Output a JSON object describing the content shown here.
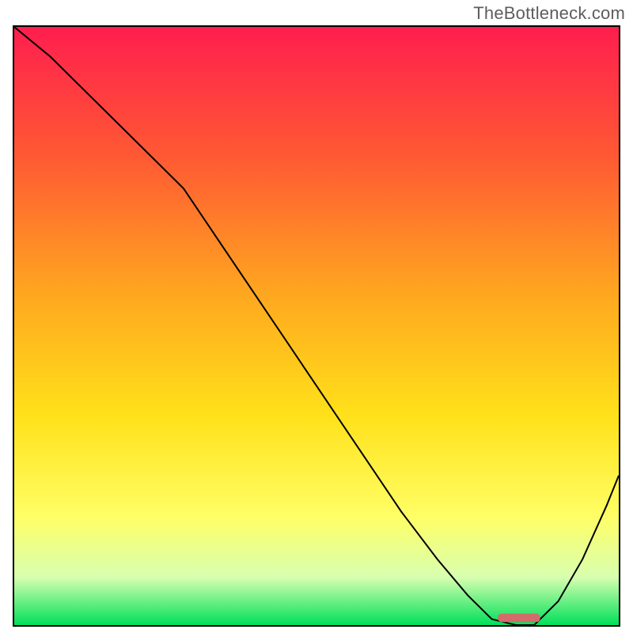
{
  "attribution": "TheBottleneck.com",
  "chart_data": {
    "type": "line",
    "title": "",
    "xlabel": "",
    "ylabel": "",
    "xlim": [
      0,
      100
    ],
    "ylim": [
      0,
      100
    ],
    "gradient_background": {
      "description": "vertical gradient red→orange→yellow→pale-yellow→green",
      "stops": [
        {
          "offset": 0.0,
          "color": "#ff1e4e"
        },
        {
          "offset": 0.22,
          "color": "#ff5a33"
        },
        {
          "offset": 0.45,
          "color": "#ffa81f"
        },
        {
          "offset": 0.65,
          "color": "#ffe11a"
        },
        {
          "offset": 0.82,
          "color": "#ffff66"
        },
        {
          "offset": 0.92,
          "color": "#d8ffb0"
        },
        {
          "offset": 1.0,
          "color": "#00e05a"
        }
      ]
    },
    "series": [
      {
        "name": "bottleneck-curve",
        "x": [
          0,
          6,
          12,
          18,
          24,
          28,
          34,
          40,
          46,
          52,
          58,
          64,
          70,
          75,
          79,
          83,
          86,
          90,
          94,
          98,
          100
        ],
        "y": [
          100,
          95,
          89,
          83,
          77,
          73,
          64,
          55,
          46,
          37,
          28,
          19,
          11,
          5,
          1,
          0,
          0,
          4,
          11,
          20,
          25
        ]
      }
    ],
    "marker": {
      "name": "optimal-range",
      "x_start": 80,
      "x_end": 87,
      "y": 0.5,
      "color": "#d46a6a"
    }
  }
}
